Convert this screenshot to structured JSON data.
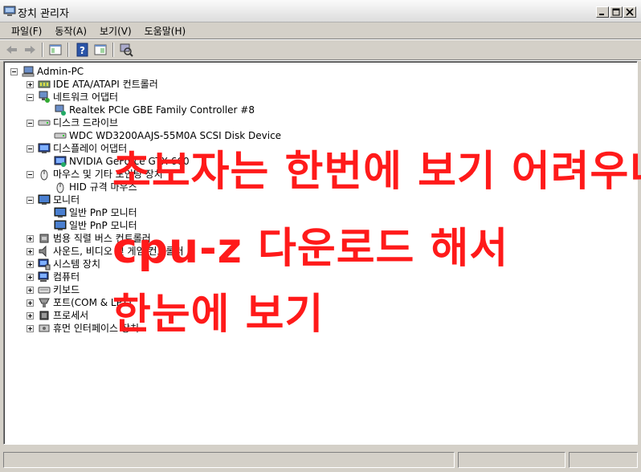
{
  "window": {
    "title": "장치 관리자"
  },
  "menu": {
    "items": [
      "파일(F)",
      "동작(A)",
      "보기(V)",
      "도움말(H)"
    ]
  },
  "tree": {
    "root": "Admin-PC",
    "nodes": [
      {
        "label": "IDE ATA/ATAPI 컨트롤러",
        "icon": "ide-controller-icon"
      },
      {
        "label": "네트워크 어댑터",
        "icon": "network-adapter-icon"
      },
      {
        "label": "Realtek PCIe GBE Family Controller #8",
        "icon": "network-card-icon"
      },
      {
        "label": "디스크 드라이브",
        "icon": "disk-drive-icon"
      },
      {
        "label": "WDC WD3200AAJS-55M0A SCSI Disk Device",
        "icon": "hard-disk-icon"
      },
      {
        "label": "디스플레이 어댑터",
        "icon": "display-adapter-icon"
      },
      {
        "label": "NVIDIA GeForce GTX 660",
        "icon": "graphics-card-icon"
      },
      {
        "label": "마우스 및 기타 포인팅 장치",
        "icon": "mouse-icon"
      },
      {
        "label": "HID 규격 마우스",
        "icon": "mouse-icon"
      },
      {
        "label": "모니터",
        "icon": "monitor-icon"
      },
      {
        "label": "일반 PnP 모니터",
        "icon": "monitor-icon"
      },
      {
        "label": "일반 PnP 모니터",
        "icon": "monitor-icon"
      },
      {
        "label": "범용 직렬 버스 컨트롤러",
        "icon": "usb-icon"
      },
      {
        "label": "사운드, 비디오 및 게임 컨트롤러",
        "icon": "speaker-icon"
      },
      {
        "label": "시스템 장치",
        "icon": "system-device-icon"
      },
      {
        "label": "컴퓨터",
        "icon": "computer-icon"
      },
      {
        "label": "키보드",
        "icon": "keyboard-icon"
      },
      {
        "label": "포트(COM & LPT)",
        "icon": "port-icon"
      },
      {
        "label": "프로세서",
        "icon": "processor-icon"
      },
      {
        "label": "휴먼 인터페이스 장치",
        "icon": "hid-icon"
      }
    ]
  },
  "overlay": {
    "line1": "초보자는 한번에 보기 어려우니",
    "line2": "cpu-z 다운로드 해서",
    "line3": "한눈에 보기",
    "color": "#ff1a1a"
  }
}
